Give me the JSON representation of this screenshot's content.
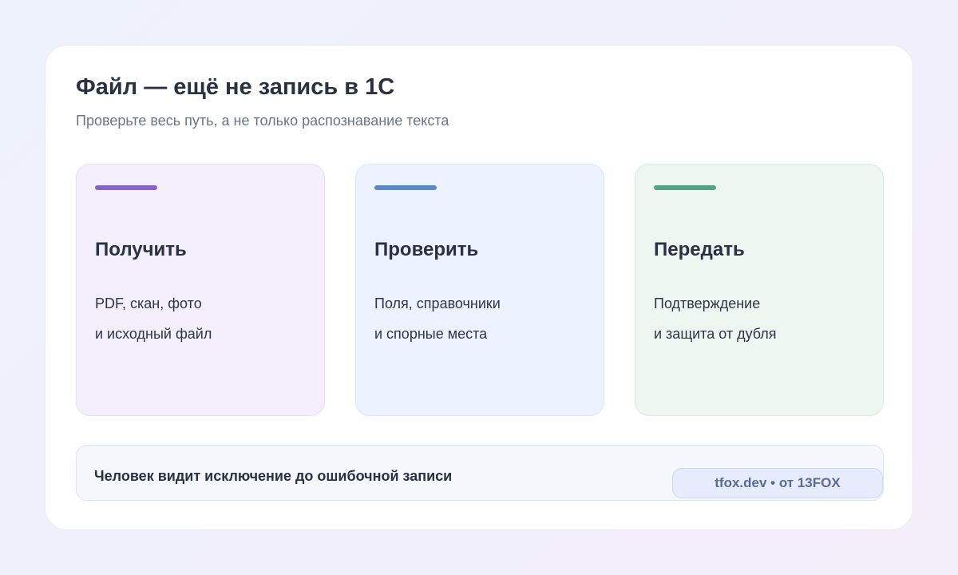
{
  "header": {
    "title": "Файл — ещё не запись в 1С",
    "subtitle": "Проверьте весь путь, а не только распознавание текста"
  },
  "steps": [
    {
      "title": "Получить",
      "lines": [
        "PDF, скан, фото",
        "и исходный файл"
      ],
      "accent_color": "#8a63c9"
    },
    {
      "title": "Проверить",
      "lines": [
        "Поля, справочники",
        "и спорные места"
      ],
      "accent_color": "#5b8ac9"
    },
    {
      "title": "Передать",
      "lines": [
        "Подтверждение",
        "и защита от дубля"
      ],
      "accent_color": "#52a388"
    }
  ],
  "footer": {
    "text": "Человек видит исключение до ошибочной записи",
    "badge": "tfox.dev • от 13FOX"
  }
}
